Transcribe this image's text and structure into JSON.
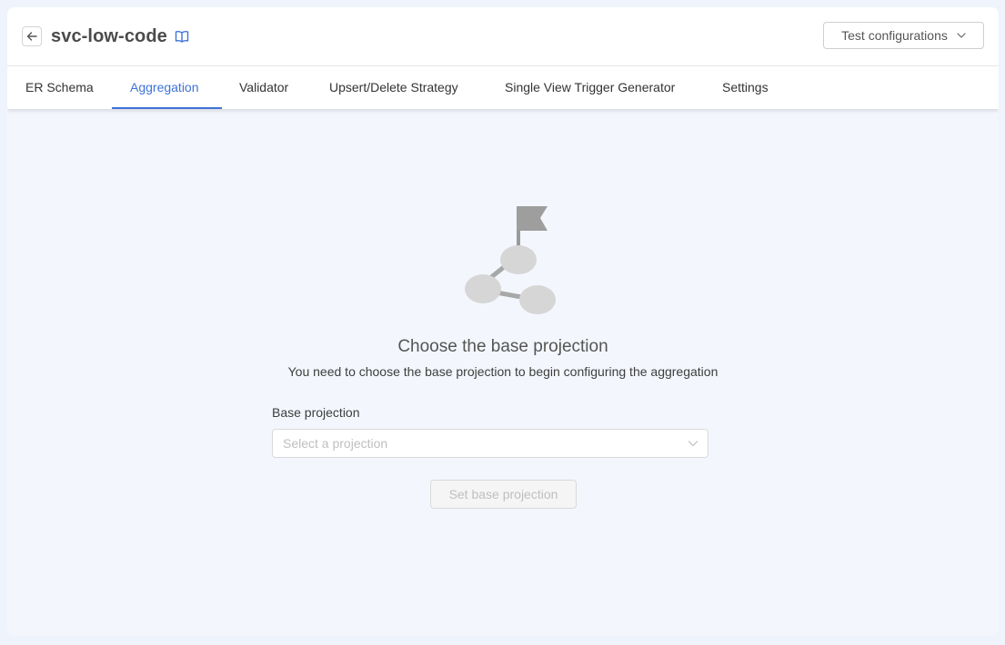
{
  "header": {
    "title": "svc-low-code",
    "test_button_label": "Test configurations"
  },
  "tabs": [
    {
      "label": "ER Schema",
      "active": false
    },
    {
      "label": "Aggregation",
      "active": true
    },
    {
      "label": "Validator",
      "active": false
    },
    {
      "label": "Upsert/Delete Strategy",
      "active": false
    },
    {
      "label": "Single View Trigger Generator",
      "active": false
    },
    {
      "label": "Settings",
      "active": false
    }
  ],
  "empty_state": {
    "heading": "Choose the base projection",
    "description": "You need to choose the base projection to begin configuring the aggregation",
    "illustration": "flag-graph-illustration"
  },
  "form": {
    "field_label": "Base projection",
    "select_placeholder": "Select a projection",
    "submit_label": "Set base projection",
    "submit_disabled": true
  },
  "colors": {
    "accent": "#3f73d8",
    "background": "#f3f7fd",
    "illustration_gray": "#d6d6d6"
  }
}
